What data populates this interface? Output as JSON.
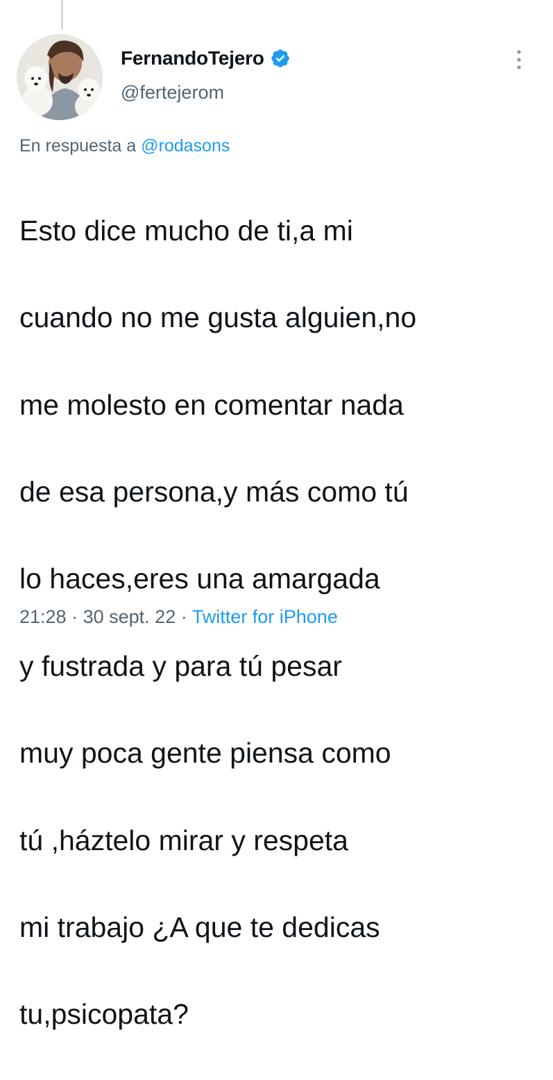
{
  "tweet": {
    "author": {
      "display_name": "FernandoTejero",
      "handle": "@fertejerom",
      "verified_icon": "verified-badge-icon",
      "avatar": "profile-photo-with-dogs"
    },
    "reply": {
      "prefix": "En respuesta a",
      "mention": "@rodasons"
    },
    "lines": [
      "Esto dice mucho de ti,a mi",
      "cuando no me gusta alguien,no",
      "me molesto en comentar nada",
      "de esa persona,y más como tú",
      "lo haces,eres una amargada",
      "y fustrada y para tú pesar",
      "muy poca gente piensa como",
      "tú ,háztelo mirar y respeta",
      "mi trabajo ¿A que te dedicas",
      "tu,psicopata?"
    ],
    "meta": {
      "time": "21:28",
      "separator": "·",
      "date": "30 sept. 22",
      "source": "Twitter for iPhone"
    },
    "more_icon": "more-vertical-icon"
  },
  "colors": {
    "text": "#0f1419",
    "secondary": "#536471",
    "accent": "#1d9bf0"
  }
}
